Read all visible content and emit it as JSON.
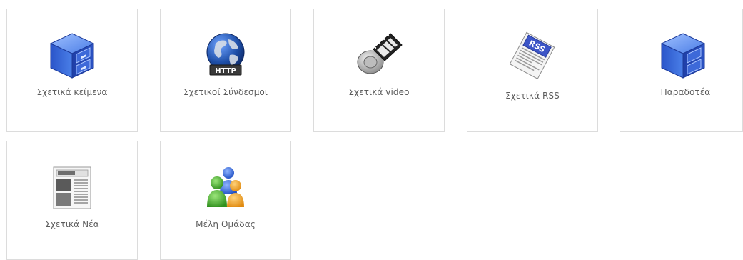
{
  "tiles": [
    {
      "label": "Σχετικά κείμενα",
      "icon": "file-cabinet-icon"
    },
    {
      "label": "Σχετικοί Σύνδεσμοι",
      "icon": "http-globe-icon",
      "badge": "HTTP"
    },
    {
      "label": "Σχετικά video",
      "icon": "video-film-icon"
    },
    {
      "label": "Σχετικά RSS",
      "icon": "rss-newspaper-icon",
      "badge": "RSS"
    },
    {
      "label": "Παραδοτέα",
      "icon": "file-cabinet-icon"
    },
    {
      "label": "Σχετικά Νέα",
      "icon": "newspaper-icon"
    },
    {
      "label": "Μέλη Ομάδας",
      "icon": "team-members-icon"
    }
  ],
  "colors": {
    "tile_border": "#dcdcdc",
    "label_text": "#5b5b5b",
    "cabinet_blue": "#3f6fe0",
    "globe_blue": "#1e4fa8",
    "rss_blue": "#3c55c7"
  }
}
